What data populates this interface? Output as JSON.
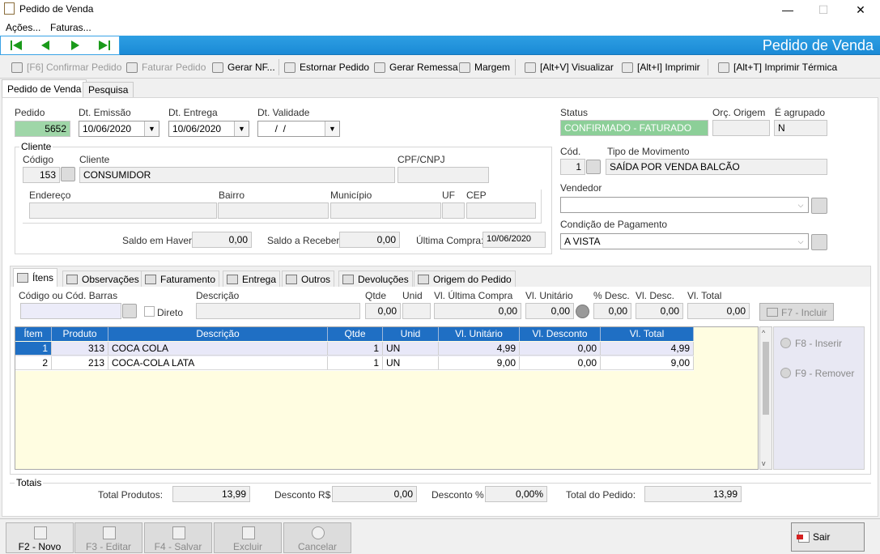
{
  "window": {
    "title": "Pedido de Venda",
    "minimize": "—",
    "maximize": "☐",
    "close": "✕"
  },
  "menu": [
    "Ações...",
    "Faturas..."
  ],
  "nav": {
    "title": "Pedido de Venda"
  },
  "toolbar": {
    "confirmar": "[F6] Confirmar Pedido",
    "faturar": "Faturar Pedido",
    "gerar_nf": "Gerar NF...",
    "estornar": "Estornar Pedido",
    "remessa": "Gerar Remessa",
    "margem": "Margem",
    "visualizar": "[Alt+V] Visualizar",
    "imprimir": "[Alt+I] Imprimir",
    "termica": "[Alt+T] Imprimir Térmica"
  },
  "tabs": {
    "pedido": "Pedido de Venda",
    "pesquisa": "Pesquisa"
  },
  "header": {
    "pedido_label": "Pedido",
    "pedido": "5652",
    "emissao_label": "Dt. Emissão",
    "emissao": "10/06/2020",
    "entrega_label": "Dt. Entrega",
    "entrega": "10/06/2020",
    "validade_label": "Dt. Validade",
    "validade": "  /  /",
    "status_label": "Status",
    "status": "CONFIRMADO - FATURADO",
    "orc_label": "Orç. Origem",
    "orc": "",
    "agrupado_label": "É agrupado",
    "agrupado": "N"
  },
  "cliente": {
    "group_label": "Cliente",
    "codigo_label": "Código",
    "codigo": "153",
    "cliente_label": "Cliente",
    "nome": "CONSUMIDOR",
    "cpf_label": "CPF/CNPJ",
    "cpf": "",
    "endereco_label": "Endereço",
    "bairro_label": "Bairro",
    "municipio_label": "Município",
    "uf_label": "UF",
    "cep_label": "CEP",
    "saldo_haver_label": "Saldo em Haver:",
    "saldo_haver": "0,00",
    "saldo_receber_label": "Saldo a Receber:",
    "saldo_receber": "0,00",
    "ultima_compra_label": "Última Compra:",
    "ultima_compra": "10/06/2020"
  },
  "movimento": {
    "cod_label": "Cód.",
    "cod": "1",
    "tipo_label": "Tipo de Movimento",
    "tipo": "SAÍDA POR VENDA BALCÃO",
    "vendedor_label": "Vendedor",
    "vendedor": "",
    "condicao_label": "Condição de Pagamento",
    "condicao": "A VISTA"
  },
  "itemtabs": [
    "Ítens",
    "Observações",
    "Faturamento",
    "Entrega",
    "Outros",
    "Devoluções",
    "Origem do Pedido"
  ],
  "itemform": {
    "codigo_label": "Código ou Cód. Barras",
    "direto_label": "Direto",
    "descricao_label": "Descrição",
    "qtde_label": "Qtde",
    "qtde": "0,00",
    "unid_label": "Unid",
    "ult_compra_label": "Vl. Última Compra",
    "ult_compra": "0,00",
    "unitario_label": "Vl. Unitário",
    "unitario": "0,00",
    "pdesc_label": "% Desc.",
    "pdesc": "0,00",
    "vdesc_label": "Vl. Desc.",
    "vdesc": "0,00",
    "vtotal_label": "Vl. Total",
    "vtotal": "0,00",
    "incluir": "F7 - Incluir"
  },
  "grid": {
    "columns": [
      "Ítem",
      "Produto",
      "Descrição",
      "Qtde",
      "Unid",
      "Vl. Unitário",
      "Vl. Desconto",
      "Vl. Total"
    ],
    "rows": [
      [
        "1",
        "313",
        "COCA COLA",
        "1",
        "UN",
        "4,99",
        "0,00",
        "4,99"
      ],
      [
        "2",
        "213",
        "COCA-COLA LATA",
        "1",
        "UN",
        "9,00",
        "0,00",
        "9,00"
      ]
    ]
  },
  "side": {
    "inserir": "F8 - Inserir",
    "remover": "F9 - Remover"
  },
  "totais": {
    "group_label": "Totais",
    "produtos_label": "Total Produtos:",
    "produtos": "13,99",
    "desconto_label": "Desconto R$",
    "desconto": "0,00",
    "pdesc_label": "Desconto %",
    "pdesc": "0,00%",
    "pedido_label": "Total do Pedido:",
    "pedido": "13,99"
  },
  "footer": {
    "novo": "F2 - Novo",
    "editar": "F3 - Editar",
    "salvar": "F4 - Salvar",
    "excluir": "Excluir",
    "cancelar": "Cancelar",
    "sair": "Sair"
  }
}
